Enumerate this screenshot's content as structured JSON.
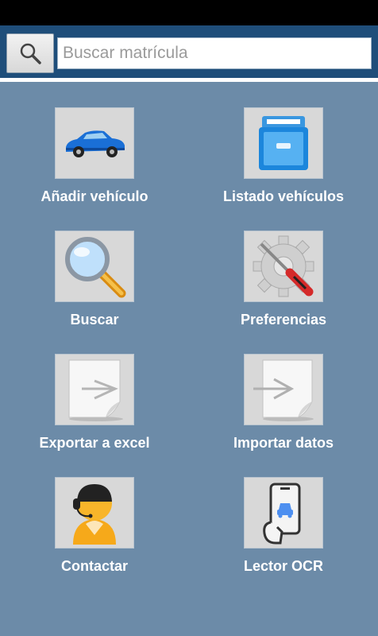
{
  "search": {
    "placeholder": "Buscar matrícula",
    "icon": "search-icon"
  },
  "menu": [
    {
      "label": "Añadir vehículo",
      "icon": "car-icon"
    },
    {
      "label": "Listado vehículos",
      "icon": "file-cabinet-icon"
    },
    {
      "label": "Buscar",
      "icon": "magnifier-icon"
    },
    {
      "label": "Preferencias",
      "icon": "gear-screwdriver-icon"
    },
    {
      "label": "Exportar a excel",
      "icon": "export-document-icon"
    },
    {
      "label": "Importar datos",
      "icon": "import-document-icon"
    },
    {
      "label": "Contactar",
      "icon": "support-agent-icon"
    },
    {
      "label": "Lector OCR",
      "icon": "phone-scan-icon"
    }
  ]
}
